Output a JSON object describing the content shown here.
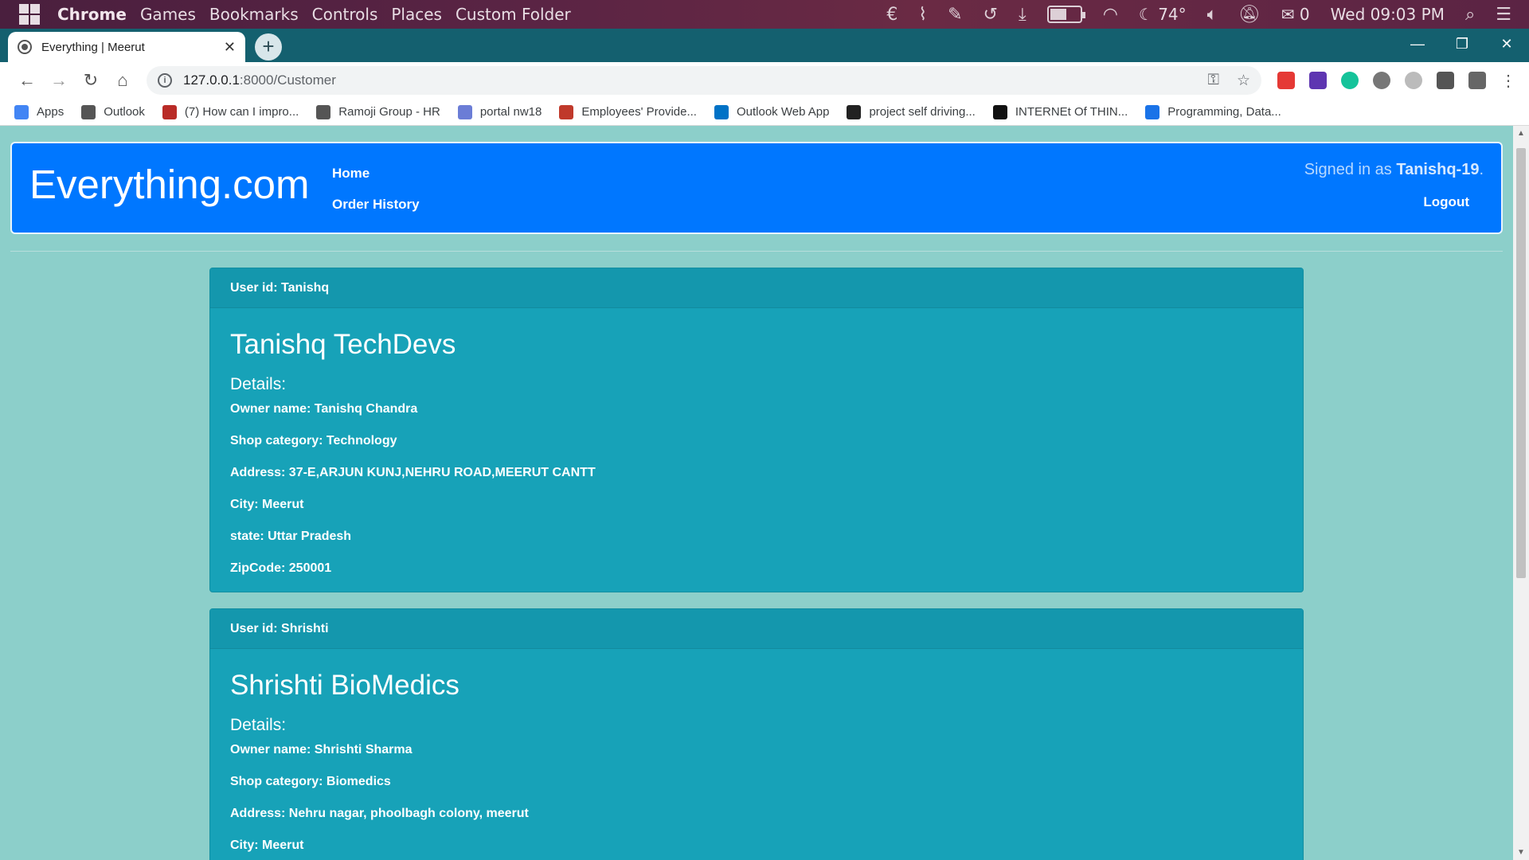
{
  "os_bar": {
    "menus": [
      "Chrome",
      "Games",
      "Bookmarks",
      "Controls",
      "Places",
      "Custom Folder"
    ],
    "weather": "74°",
    "mail_count": "0",
    "clock": "Wed 09:03 PM",
    "battery_level_pct": 55
  },
  "browser": {
    "tab_title": "Everything | Meerut",
    "url_host": "127.0.0.1",
    "url_path": ":8000/Customer",
    "bookmarks": [
      {
        "label": "Apps",
        "color": "#4285f4"
      },
      {
        "label": "Outlook",
        "color": "#555555"
      },
      {
        "label": "(7) How can I impro...",
        "color": "#b92b27"
      },
      {
        "label": "Ramoji Group - HR",
        "color": "#555555"
      },
      {
        "label": "portal nw18",
        "color": "#6b7dd6"
      },
      {
        "label": "Employees' Provide...",
        "color": "#c0392b"
      },
      {
        "label": "Outlook Web App",
        "color": "#0072c6"
      },
      {
        "label": "project self driving...",
        "color": "#222222"
      },
      {
        "label": "INTERNEt Of THIN...",
        "color": "#111111"
      },
      {
        "label": "Programming, Data...",
        "color": "#1a73e8"
      }
    ]
  },
  "page": {
    "brand": "Everything.com",
    "nav": {
      "home": "Home",
      "orders": "Order History"
    },
    "signed_in_prefix": "Signed in as ",
    "signed_in_user": "Tanishq-19",
    "signed_in_suffix": ".",
    "logout": "Logout",
    "accent": "#0077ff",
    "card_color": "#17a2b8",
    "shops": [
      {
        "user_id": "User id: Tanishq",
        "name": "Tanishq TechDevs",
        "details_label": "Details:",
        "owner": "Owner name: Tanishq Chandra",
        "category": "Shop category: Technology",
        "address": "Address: 37-E,ARJUN KUNJ,NEHRU ROAD,MEERUT CANTT",
        "city": "City: Meerut",
        "state": "state: Uttar Pradesh",
        "zip": "ZipCode: 250001"
      },
      {
        "user_id": "User id: Shrishti",
        "name": "Shrishti BioMedics",
        "details_label": "Details:",
        "owner": "Owner name: Shrishti Sharma",
        "category": "Shop category: Biomedics",
        "address": "Address: Nehru nagar, phoolbagh colony, meerut",
        "city": "City: Meerut"
      }
    ]
  }
}
